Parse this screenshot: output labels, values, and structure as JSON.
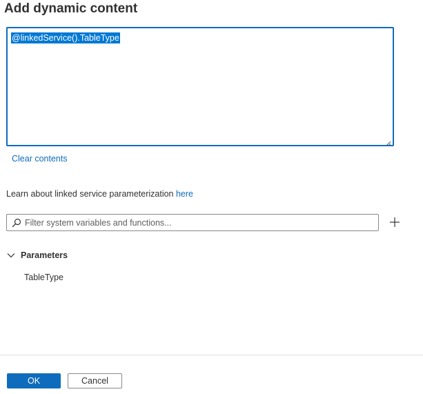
{
  "dialog": {
    "title": "Add dynamic content"
  },
  "editor": {
    "value": "@linkedService().TableType"
  },
  "clear_link": "Clear contents",
  "learn": {
    "text": "Learn about linked service parameterization ",
    "link": "here"
  },
  "filter": {
    "placeholder": "Filter system variables and functions...",
    "value": ""
  },
  "parameters": {
    "label": "Parameters",
    "items": [
      "TableType"
    ]
  },
  "footer": {
    "ok_label": "OK",
    "cancel_label": "Cancel"
  },
  "colors": {
    "accent": "#0f6cbd",
    "selection": "#0078d4"
  },
  "icons": {
    "filter": "search-icon",
    "add": "plus-icon",
    "section": "chevron-down-icon",
    "resize": "resize-grip-icon"
  }
}
